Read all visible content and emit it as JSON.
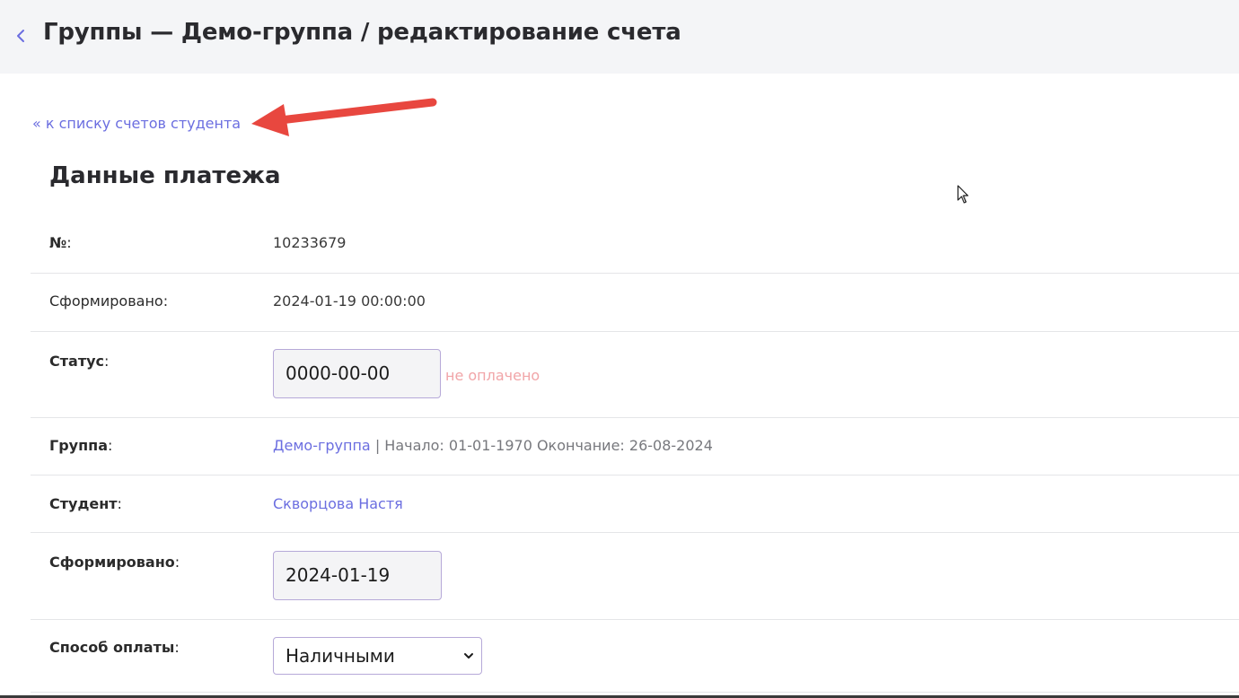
{
  "header": {
    "title": "Группы — Демо-группа / редактирование счета"
  },
  "back_link": "« к списку счетов студента",
  "section_title": "Данные платежа",
  "fields": {
    "number": {
      "label": "№",
      "value": "10233679"
    },
    "created": {
      "label": "Сформировано:",
      "value": "2024-01-19 00:00:00"
    },
    "status": {
      "label": "Статус",
      "input_value": "0000-00-00",
      "status_text": "не оплачено"
    },
    "group": {
      "label": "Группа",
      "link": "Демо-группа",
      "separator": " | ",
      "dates": "Начало: 01-01-1970 Окончание: 26-08-2024"
    },
    "student": {
      "label": "Студент",
      "link": "Скворцова Настя"
    },
    "formed_date": {
      "label": "Сформировано",
      "input_value": "2024-01-19"
    },
    "payment_method": {
      "label": "Способ оплаты",
      "selected": "Наличными"
    }
  },
  "colors": {
    "accent": "#6b6ee0",
    "annotation_arrow": "#e8473f",
    "unpaid": "#f1a5a8"
  }
}
